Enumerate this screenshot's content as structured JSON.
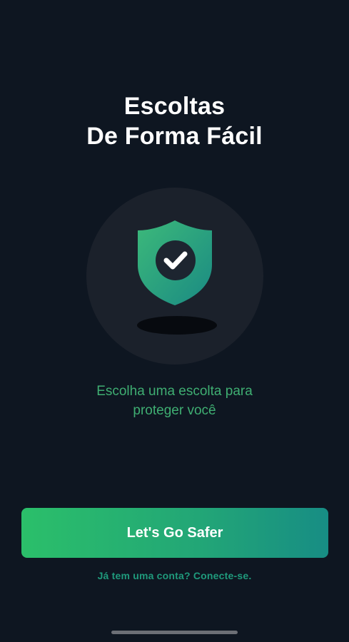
{
  "header": {
    "title_line1": "Escoltas",
    "title_line2": "De Forma Fácil"
  },
  "illustration": {
    "icon": "shield-check-icon",
    "colors": {
      "shield_top": "#3cb97a",
      "shield_bottom": "#1a8a83",
      "check_circle": "#1d2530"
    }
  },
  "subtitle": {
    "line1": "Escolha uma escolta para",
    "line2": "proteger você"
  },
  "cta": {
    "label": "Let's Go Safer"
  },
  "login": {
    "label": "Já tem uma conta? Conecte-se."
  },
  "theme": {
    "background": "#0e1621",
    "accent": "#2bbf6a",
    "accent_text": "#3fae72"
  }
}
